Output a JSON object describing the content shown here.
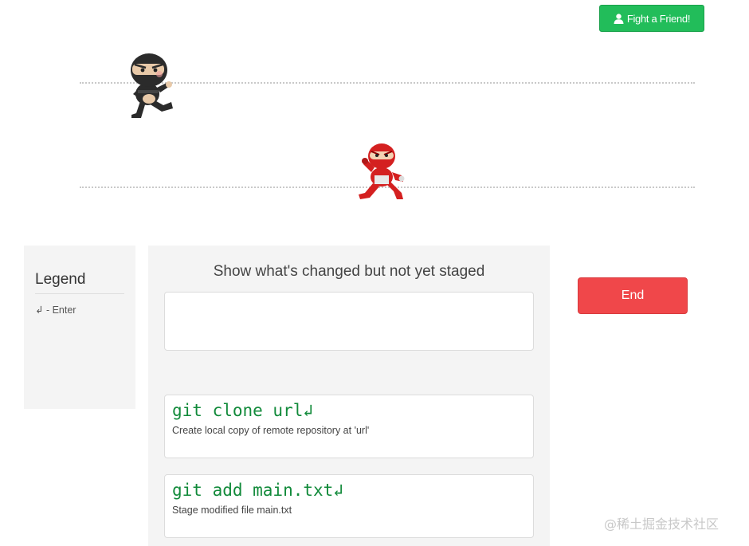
{
  "header": {
    "fight_button": {
      "label": "Fight a Friend!",
      "icon": "user-icon"
    }
  },
  "arena": {
    "player_ninja": {
      "icon": "black-ninja",
      "color": "#2b2b2b"
    },
    "opponent_ninja": {
      "icon": "red-ninja",
      "color": "#d42020"
    }
  },
  "legend": {
    "title": "Legend",
    "items": [
      {
        "label": "↲ - Enter"
      }
    ]
  },
  "question": {
    "prompt": "Show what's changed but not yet staged",
    "answer_value": ""
  },
  "commands": [
    {
      "code": "git clone url↲",
      "description": "Create local copy of remote repository at 'url'"
    },
    {
      "code": "git add main.txt↲",
      "description": "Stage modified file main.txt"
    }
  ],
  "end_button": {
    "label": "End"
  },
  "watermark": "@稀土掘金技术社区",
  "colors": {
    "fight_button": "#22bd5a",
    "end_button": "#f0474a",
    "command_text": "#118a3a",
    "panel_bg": "#f4f4f4"
  }
}
